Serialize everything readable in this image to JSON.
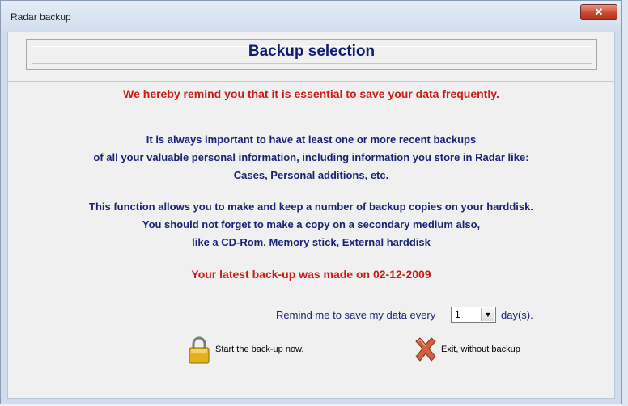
{
  "window": {
    "title": "Radar backup",
    "close_glyph": "✕"
  },
  "header": {
    "title": "Backup selection"
  },
  "messages": {
    "reminder": "We hereby remind you that it is essential to save your data frequently.",
    "para1_line1": "It is always important to have at least one or more recent backups",
    "para1_line2": "of all your valuable personal information, including information you store in Radar like:",
    "para1_line3": "Cases, Personal additions, etc.",
    "para2_line1": "This function allows you to make and keep a number of backup copies on your harddisk.",
    "para2_line2": "You should not forget to make a copy on a secondary medium also,",
    "para2_line3": "like a CD-Rom, Memory stick, External harddisk",
    "latest_backup": "Your latest back-up was made on 02-12-2009"
  },
  "reminder_setting": {
    "label": "Remind me to save my data every",
    "value": "1",
    "unit": "day(s)."
  },
  "actions": {
    "start_label": "Start the back-up now.",
    "start_icon": "padlock-icon",
    "exit_label": "Exit, without backup",
    "exit_icon": "red-x-icon"
  },
  "colors": {
    "title_blue": "#101c74",
    "text_blue": "#1a2378",
    "text_red": "#cc1c12"
  }
}
